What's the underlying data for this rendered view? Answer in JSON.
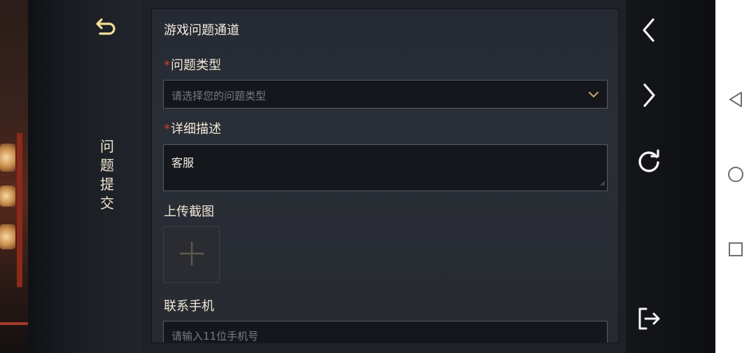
{
  "sidebar": {
    "back_icon": "return-arrow-icon",
    "title": "问题提交"
  },
  "form": {
    "title": "游戏问题通道",
    "required_mark": "*",
    "issue_type": {
      "label": "问题类型",
      "placeholder": "请选择您的问题类型",
      "icon": "chevron-down-icon"
    },
    "details": {
      "label": "详细描述",
      "value": "客服"
    },
    "upload": {
      "label": "上传截图",
      "icon": "plus-icon"
    },
    "phone": {
      "label": "联系手机",
      "placeholder": "请输入11位手机号"
    }
  },
  "right_nav": {
    "icons": [
      "chevron-left-icon",
      "chevron-right-icon",
      "refresh-icon",
      "exit-icon"
    ]
  },
  "system_nav": {
    "icons": [
      "back-triangle-icon",
      "home-circle-icon",
      "recents-square-icon"
    ]
  },
  "colors": {
    "accent_gold": "#c9a86a",
    "required_red": "#d23a2a",
    "panel_bg": "#272a31"
  }
}
